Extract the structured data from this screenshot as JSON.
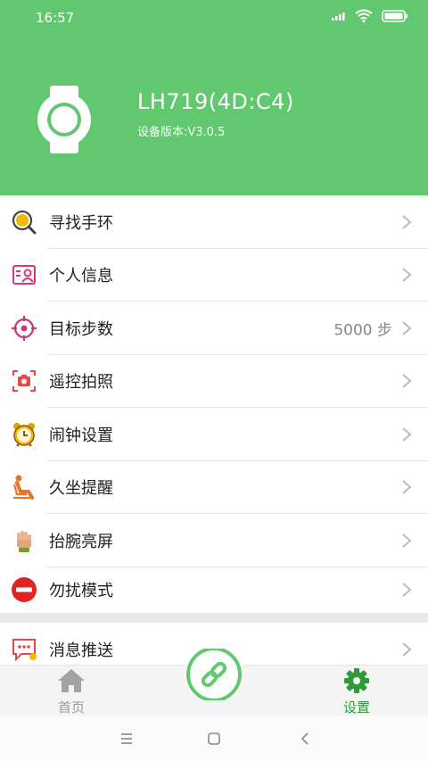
{
  "status_bar": {
    "time": "16:57"
  },
  "device": {
    "name": "LH719(4D:C4)",
    "version": "设备版本:V3.0.5"
  },
  "menu": [
    {
      "label": "寻找手环",
      "value": ""
    },
    {
      "label": "个人信息",
      "value": ""
    },
    {
      "label": "目标步数",
      "value": "5000 步"
    },
    {
      "label": "遥控拍照",
      "value": ""
    },
    {
      "label": "闹钟设置",
      "value": ""
    },
    {
      "label": "久坐提醒",
      "value": ""
    },
    {
      "label": "抬腕亮屏",
      "value": ""
    },
    {
      "label": "勿扰模式",
      "value": ""
    },
    {
      "label": "消息推送",
      "value": ""
    }
  ],
  "tabbar": {
    "home_label": "首页",
    "settings_label": "设置"
  },
  "colors": {
    "header": "#62c86f",
    "accent": "#2f9a3a",
    "dnd": "#e02424"
  }
}
